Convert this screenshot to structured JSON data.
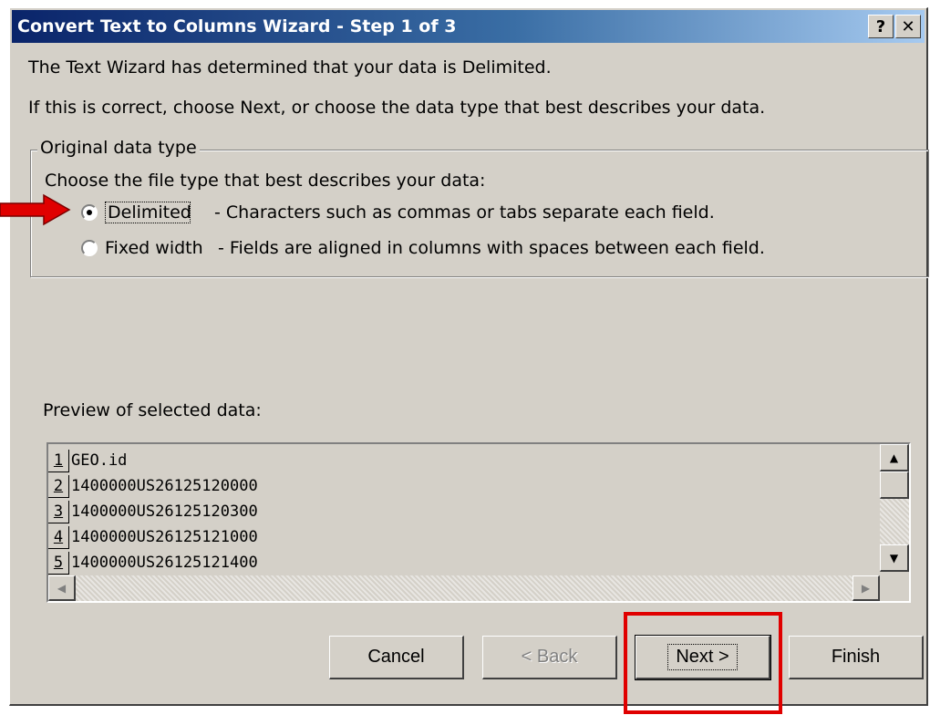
{
  "dialog": {
    "title": "Convert Text to Columns Wizard - Step 1 of 3",
    "help_label": "?",
    "close_label": "✕"
  },
  "intro": {
    "line1": "The Text Wizard has determined that your data is Delimited.",
    "line2": "If this is correct, choose Next, or choose the data type that best describes your data."
  },
  "original_data_type": {
    "legend": "Original data type",
    "prompt": "Choose the file type that best describes your data:",
    "options": [
      {
        "label": "Delimited",
        "description": "- Characters such as commas or tabs separate each field.",
        "selected": true
      },
      {
        "label": "Fixed width",
        "description": "- Fields are aligned in columns with spaces between each field.",
        "selected": false
      }
    ]
  },
  "preview": {
    "label": "Preview of selected data:",
    "rows": [
      {
        "num": "1",
        "text": "GEO.id"
      },
      {
        "num": "2",
        "text": "1400000US26125120000"
      },
      {
        "num": "3",
        "text": "1400000US26125120300"
      },
      {
        "num": "4",
        "text": "1400000US26125121000"
      },
      {
        "num": "5",
        "text": "1400000US26125121400"
      }
    ]
  },
  "buttons": {
    "cancel": "Cancel",
    "back": "< Back",
    "next": "Next >",
    "finish": "Finish"
  },
  "annotations": {
    "arrow_color": "#e00000",
    "highlight_color": "#e00000"
  }
}
